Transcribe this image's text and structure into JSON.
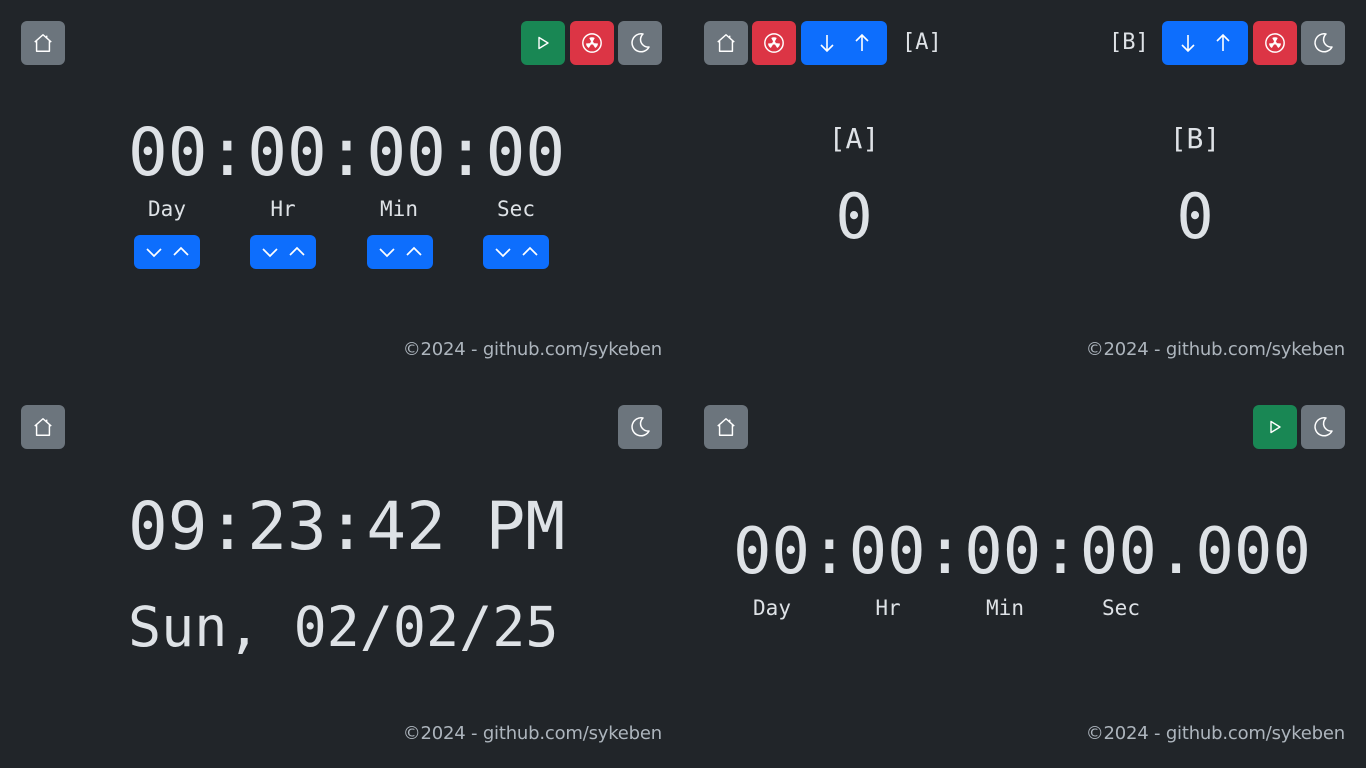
{
  "timer": {
    "display": "00:00:00:00",
    "units": [
      "Day",
      "Hr",
      "Min",
      "Sec"
    ],
    "footer": "©2024 - github.com/sykeben"
  },
  "scoreboard": {
    "team_a_button_label": "[A]",
    "team_b_button_label": "[B]",
    "team_a_heading": "[A]",
    "team_b_heading": "[B]",
    "team_a_score": "0",
    "team_b_score": "0",
    "footer": "©2024 - github.com/sykeben"
  },
  "clock": {
    "time": "09:23:42 PM",
    "date": "Sun, 02/02/25",
    "footer": "©2024 - github.com/sykeben"
  },
  "stopwatch": {
    "display": "00:00:00:00.000",
    "units": [
      "Day",
      "Hr",
      "Min",
      "Sec"
    ],
    "footer": "©2024 - github.com/sykeben"
  },
  "colors": {
    "background": "#212529",
    "gray_button": "#6c757d",
    "play_button": "#198754",
    "reset_button": "#dc3545",
    "adjust_button": "#0d6efd"
  },
  "icons": [
    "home-icon",
    "play-icon",
    "radiation-reset-icon",
    "moon-icon",
    "arrow-down-icon",
    "arrow-up-icon",
    "chevron-down-icon",
    "chevron-up-icon"
  ]
}
